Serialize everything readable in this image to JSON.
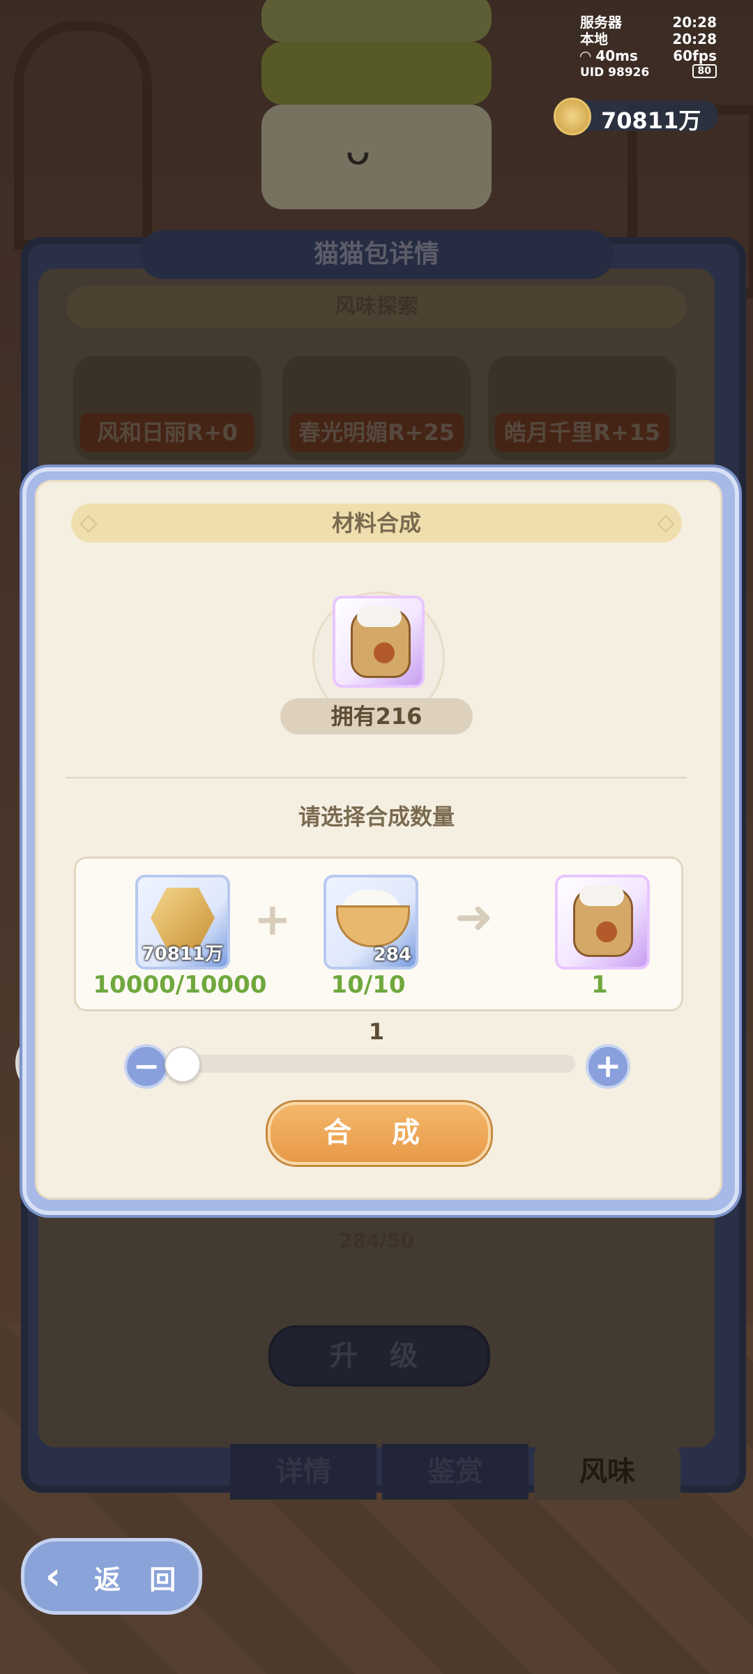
{
  "hud": {
    "server_label": "服务器",
    "server_time": "20:28",
    "local_label": "本地",
    "local_time": "20:28",
    "ping": "40ms",
    "fps": "60fps",
    "uid": "UID 98926",
    "battery": "80",
    "wifi_icon": "wifi-icon"
  },
  "currency": {
    "amount": "70811万",
    "icon": "gold-coin-icon"
  },
  "background": {
    "panel_title": "猫猫包详情",
    "section_title": "风味探索",
    "flavors": [
      "风和日丽R+0",
      "春光明媚R+25",
      "皓月千里R+15"
    ],
    "material_count": "284/50",
    "upgrade_label": "升 级",
    "tabs": [
      "详情",
      "鉴赏",
      "风味"
    ],
    "active_tab": "风味"
  },
  "back_button": {
    "label": "返 回",
    "icon": "back-arrow-icon"
  },
  "chat": {
    "icon": "chat-bubble-icon"
  },
  "modal": {
    "title": "材料合成",
    "result_item": {
      "icon": "flour-sack-icon",
      "owned_label": "拥有216"
    },
    "prompt": "请选择合成数量",
    "inputs": [
      {
        "icon": "gold-hexagon-icon",
        "count": "70811万",
        "requirement": "10000/10000"
      },
      {
        "icon": "rice-bowl-icon",
        "count": "284",
        "requirement": "10/10"
      }
    ],
    "output": {
      "icon": "flour-sack-icon",
      "amount": "1"
    },
    "quantity": "1",
    "slider": {
      "value": 1,
      "fraction": 0
    },
    "minus_icon": "minus-icon",
    "plus_icon": "plus-icon",
    "synthesize_label": "合 成",
    "accent_color": "#6fa83e",
    "button_color": "#e89a48"
  }
}
